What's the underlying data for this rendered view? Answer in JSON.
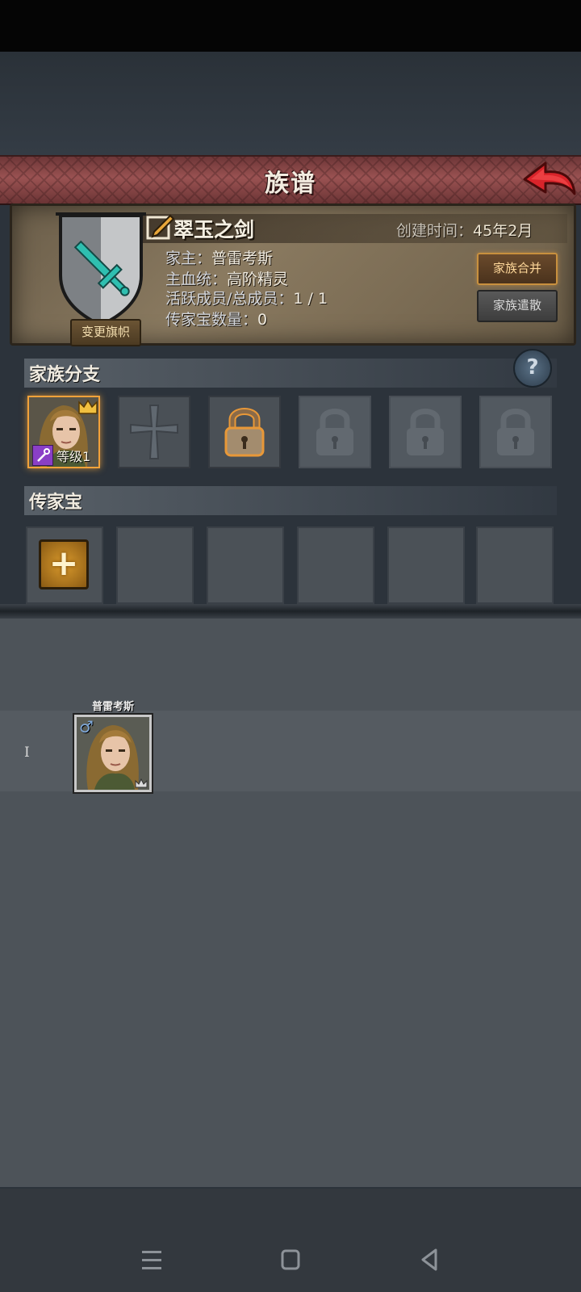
{
  "header": {
    "title": "族谱"
  },
  "family": {
    "name": "翠玉之剑",
    "created_label": "创建时间：",
    "created_value": "45年2月",
    "change_banner_label": "变更旗帜",
    "head_label": "家主：",
    "head_value": "普雷考斯",
    "bloodline_label": "主血统：",
    "bloodline_value": "高阶精灵",
    "members_label": "活跃成员/总成员：",
    "members_value": "1 / 1",
    "heirloom_count_label": "传家宝数量：",
    "heirloom_count_value": "0",
    "merge_label": "家族合并",
    "disband_label": "家族遣散"
  },
  "branches": {
    "title": "家族分支",
    "help_icon": "?",
    "level_label": "等级1"
  },
  "heirlooms": {
    "title": "传家宝",
    "add_icon": "+"
  },
  "tree": {
    "generation_label": "I",
    "member_name": "普雷考斯",
    "gender_symbol": "♂"
  },
  "colors": {
    "title_bar": "#9a5252",
    "panel": "#8a7a60",
    "accent_gold": "#f2a23a",
    "back_arrow": "#d8242a"
  }
}
